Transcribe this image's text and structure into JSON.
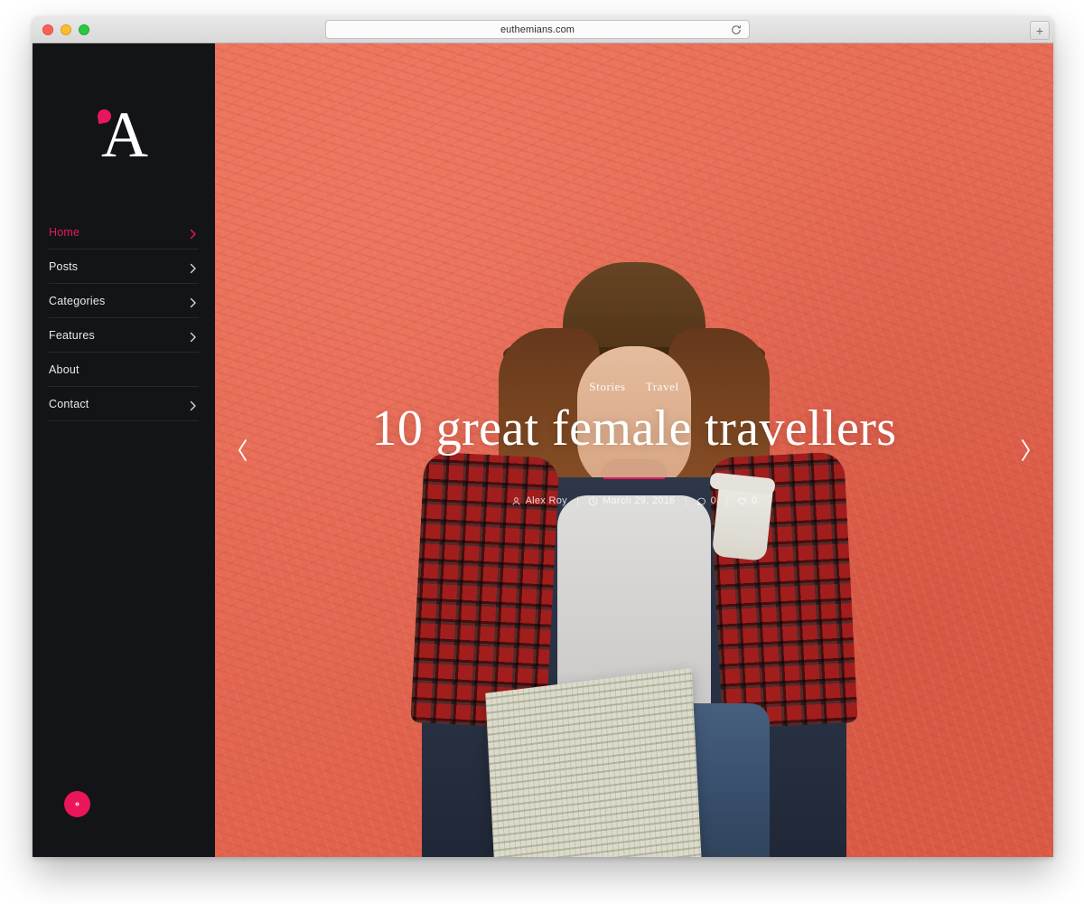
{
  "browser": {
    "url": "euthemians.com",
    "reload_icon": "reload-icon",
    "newtab_label": "+",
    "traffic_lights": [
      "close",
      "minimize",
      "maximize"
    ]
  },
  "sidebar": {
    "logo": {
      "letter": "A",
      "mark": "comma-mark"
    },
    "nav_items": [
      {
        "label": "Home",
        "active": true,
        "chevron": true
      },
      {
        "label": "Posts",
        "active": false,
        "chevron": true
      },
      {
        "label": "Categories",
        "active": false,
        "chevron": true
      },
      {
        "label": "Features",
        "active": false,
        "chevron": true
      },
      {
        "label": "About",
        "active": false,
        "chevron": false
      },
      {
        "label": "Contact",
        "active": false,
        "chevron": true
      }
    ],
    "settings_button": {
      "icon": "gear-icon"
    }
  },
  "hero": {
    "categories": [
      "Stories",
      "Travel"
    ],
    "title": "10 great female travellers",
    "meta": {
      "author": "Alex Roy",
      "date": "March 29, 2016",
      "comments": "0",
      "likes": "0"
    },
    "prev_arrow": "chevron-left-icon",
    "next_arrow": "chevron-right-icon"
  },
  "colors": {
    "accent_pink": "#e8175d",
    "sidebar_bg": "#121418",
    "hero_bg": "#f0705a",
    "text_light": "#ffffff"
  }
}
